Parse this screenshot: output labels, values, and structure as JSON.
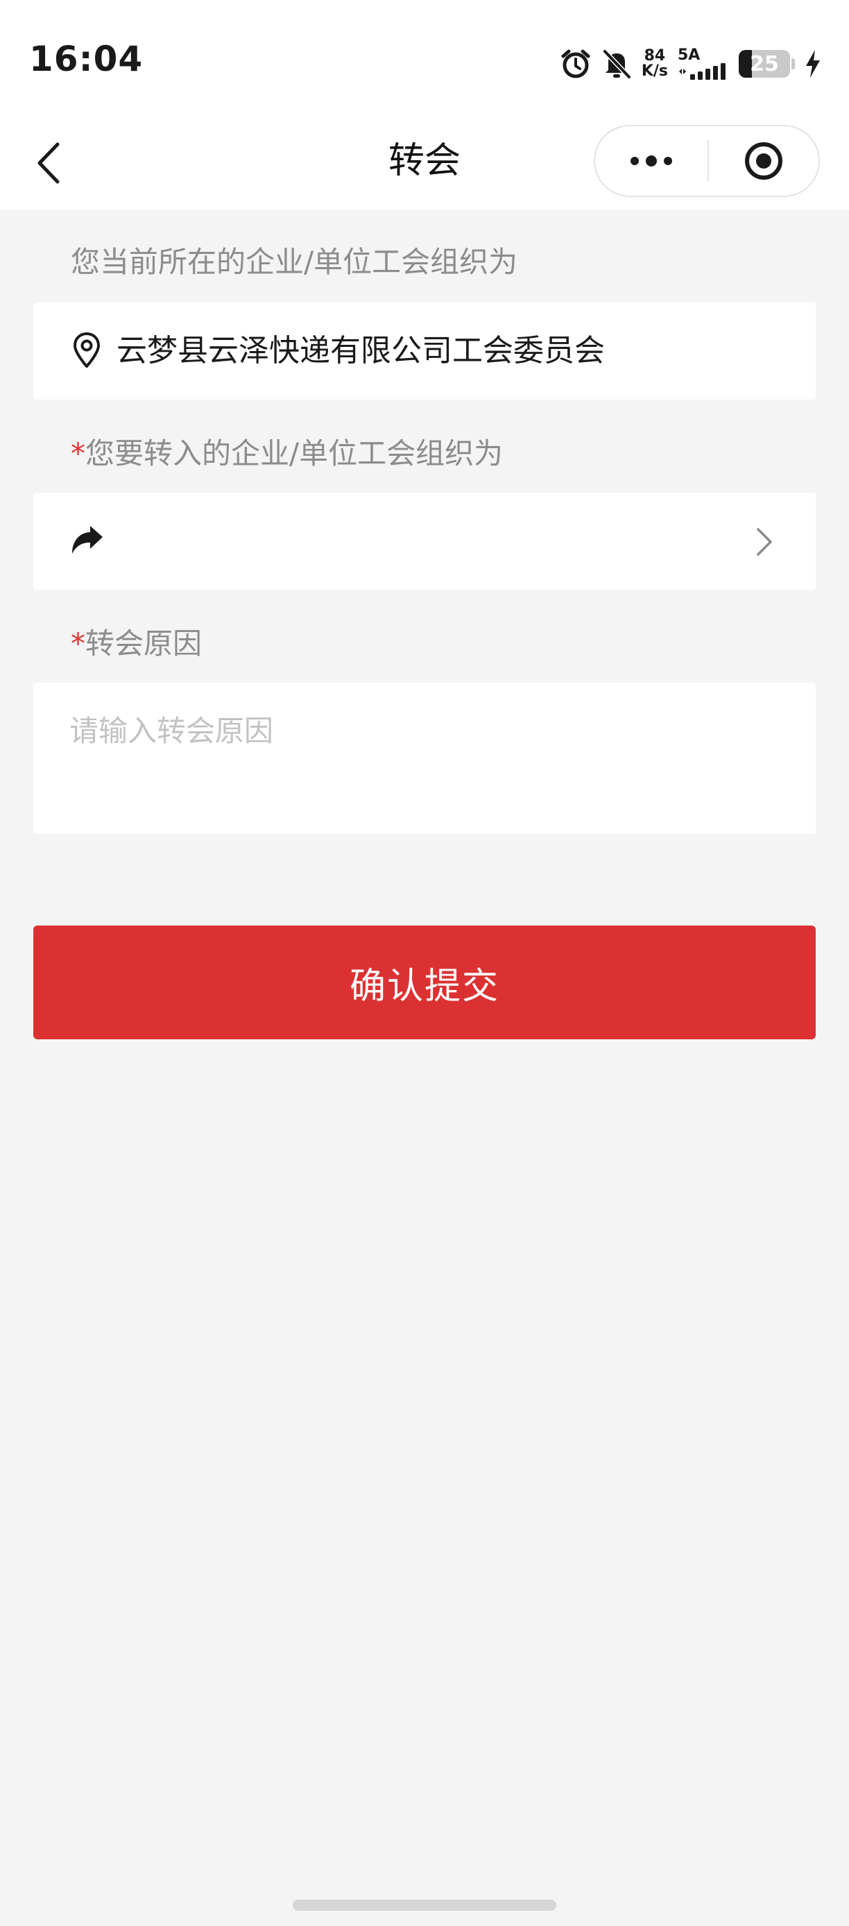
{
  "status_bar": {
    "time": "16:04",
    "net_speed_value": "84",
    "net_speed_unit": "K/s",
    "signal_label": "5A",
    "battery_level": "25",
    "battery_fraction": 0.25
  },
  "nav": {
    "title": "转会"
  },
  "form": {
    "current_org_label": "您当前所在的企业/单位工会组织为",
    "current_org_value": "云梦县云泽快递有限公司工会委员会",
    "target_org_required_mark": "*",
    "target_org_label": "您要转入的企业/单位工会组织为",
    "target_org_value": "",
    "reason_required_mark": "*",
    "reason_label": "转会原因",
    "reason_placeholder": "请输入转会原因"
  },
  "submit": {
    "label": "确认提交"
  },
  "colors": {
    "accent_red": "#dc3132",
    "required_red": "#e03434",
    "page_bg": "#f4f4f4"
  }
}
